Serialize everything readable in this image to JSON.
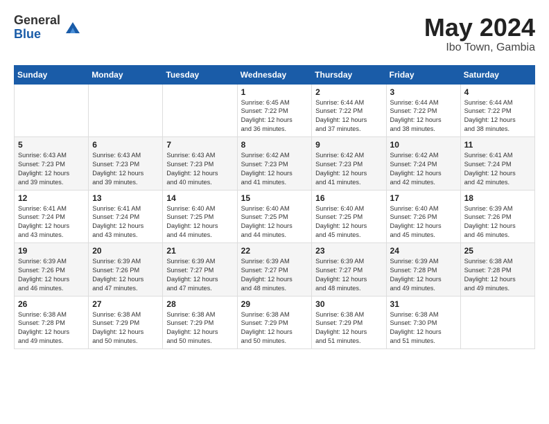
{
  "header": {
    "logo_general": "General",
    "logo_blue": "Blue",
    "month_title": "May 2024",
    "location": "Ibo Town, Gambia"
  },
  "days_of_week": [
    "Sunday",
    "Monday",
    "Tuesday",
    "Wednesday",
    "Thursday",
    "Friday",
    "Saturday"
  ],
  "weeks": [
    [
      {
        "day": "",
        "content": ""
      },
      {
        "day": "",
        "content": ""
      },
      {
        "day": "",
        "content": ""
      },
      {
        "day": "1",
        "content": "Sunrise: 6:45 AM\nSunset: 7:22 PM\nDaylight: 12 hours\nand 36 minutes."
      },
      {
        "day": "2",
        "content": "Sunrise: 6:44 AM\nSunset: 7:22 PM\nDaylight: 12 hours\nand 37 minutes."
      },
      {
        "day": "3",
        "content": "Sunrise: 6:44 AM\nSunset: 7:22 PM\nDaylight: 12 hours\nand 38 minutes."
      },
      {
        "day": "4",
        "content": "Sunrise: 6:44 AM\nSunset: 7:22 PM\nDaylight: 12 hours\nand 38 minutes."
      }
    ],
    [
      {
        "day": "5",
        "content": "Sunrise: 6:43 AM\nSunset: 7:23 PM\nDaylight: 12 hours\nand 39 minutes."
      },
      {
        "day": "6",
        "content": "Sunrise: 6:43 AM\nSunset: 7:23 PM\nDaylight: 12 hours\nand 39 minutes."
      },
      {
        "day": "7",
        "content": "Sunrise: 6:43 AM\nSunset: 7:23 PM\nDaylight: 12 hours\nand 40 minutes."
      },
      {
        "day": "8",
        "content": "Sunrise: 6:42 AM\nSunset: 7:23 PM\nDaylight: 12 hours\nand 41 minutes."
      },
      {
        "day": "9",
        "content": "Sunrise: 6:42 AM\nSunset: 7:23 PM\nDaylight: 12 hours\nand 41 minutes."
      },
      {
        "day": "10",
        "content": "Sunrise: 6:42 AM\nSunset: 7:24 PM\nDaylight: 12 hours\nand 42 minutes."
      },
      {
        "day": "11",
        "content": "Sunrise: 6:41 AM\nSunset: 7:24 PM\nDaylight: 12 hours\nand 42 minutes."
      }
    ],
    [
      {
        "day": "12",
        "content": "Sunrise: 6:41 AM\nSunset: 7:24 PM\nDaylight: 12 hours\nand 43 minutes."
      },
      {
        "day": "13",
        "content": "Sunrise: 6:41 AM\nSunset: 7:24 PM\nDaylight: 12 hours\nand 43 minutes."
      },
      {
        "day": "14",
        "content": "Sunrise: 6:40 AM\nSunset: 7:25 PM\nDaylight: 12 hours\nand 44 minutes."
      },
      {
        "day": "15",
        "content": "Sunrise: 6:40 AM\nSunset: 7:25 PM\nDaylight: 12 hours\nand 44 minutes."
      },
      {
        "day": "16",
        "content": "Sunrise: 6:40 AM\nSunset: 7:25 PM\nDaylight: 12 hours\nand 45 minutes."
      },
      {
        "day": "17",
        "content": "Sunrise: 6:40 AM\nSunset: 7:26 PM\nDaylight: 12 hours\nand 45 minutes."
      },
      {
        "day": "18",
        "content": "Sunrise: 6:39 AM\nSunset: 7:26 PM\nDaylight: 12 hours\nand 46 minutes."
      }
    ],
    [
      {
        "day": "19",
        "content": "Sunrise: 6:39 AM\nSunset: 7:26 PM\nDaylight: 12 hours\nand 46 minutes."
      },
      {
        "day": "20",
        "content": "Sunrise: 6:39 AM\nSunset: 7:26 PM\nDaylight: 12 hours\nand 47 minutes."
      },
      {
        "day": "21",
        "content": "Sunrise: 6:39 AM\nSunset: 7:27 PM\nDaylight: 12 hours\nand 47 minutes."
      },
      {
        "day": "22",
        "content": "Sunrise: 6:39 AM\nSunset: 7:27 PM\nDaylight: 12 hours\nand 48 minutes."
      },
      {
        "day": "23",
        "content": "Sunrise: 6:39 AM\nSunset: 7:27 PM\nDaylight: 12 hours\nand 48 minutes."
      },
      {
        "day": "24",
        "content": "Sunrise: 6:39 AM\nSunset: 7:28 PM\nDaylight: 12 hours\nand 49 minutes."
      },
      {
        "day": "25",
        "content": "Sunrise: 6:38 AM\nSunset: 7:28 PM\nDaylight: 12 hours\nand 49 minutes."
      }
    ],
    [
      {
        "day": "26",
        "content": "Sunrise: 6:38 AM\nSunset: 7:28 PM\nDaylight: 12 hours\nand 49 minutes."
      },
      {
        "day": "27",
        "content": "Sunrise: 6:38 AM\nSunset: 7:29 PM\nDaylight: 12 hours\nand 50 minutes."
      },
      {
        "day": "28",
        "content": "Sunrise: 6:38 AM\nSunset: 7:29 PM\nDaylight: 12 hours\nand 50 minutes."
      },
      {
        "day": "29",
        "content": "Sunrise: 6:38 AM\nSunset: 7:29 PM\nDaylight: 12 hours\nand 50 minutes."
      },
      {
        "day": "30",
        "content": "Sunrise: 6:38 AM\nSunset: 7:29 PM\nDaylight: 12 hours\nand 51 minutes."
      },
      {
        "day": "31",
        "content": "Sunrise: 6:38 AM\nSunset: 7:30 PM\nDaylight: 12 hours\nand 51 minutes."
      },
      {
        "day": "",
        "content": ""
      }
    ]
  ]
}
